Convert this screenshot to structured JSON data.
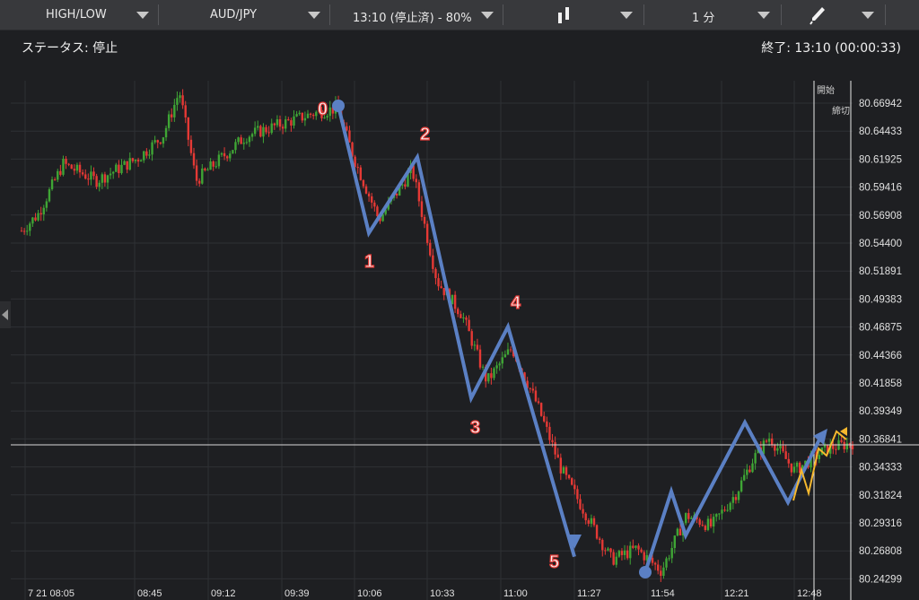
{
  "toolbar": {
    "trade_type": "HIGH/LOW",
    "pair": "AUD/JPY",
    "expiry": "13:10 (停止済) - 80%",
    "interval": "1 分"
  },
  "status": {
    "left": "ステータス: 停止",
    "right": "終了: 13:10 (00:00:33)"
  },
  "markers": {
    "start": "開始",
    "deadline": "締切"
  },
  "colors": {
    "up": "#3fa535",
    "down": "#e53935",
    "wave": "#5b80c4",
    "projection": "#f5b82e",
    "background": "#1e1f22"
  },
  "chart_data": {
    "type": "candlestick",
    "y_ticks": [
      "80.66942",
      "80.64433",
      "80.61925",
      "80.59416",
      "80.56908",
      "80.54400",
      "80.51891",
      "80.49383",
      "80.46875",
      "80.44366",
      "80.41858",
      "80.39349",
      "80.36841",
      "80.34333",
      "80.31824",
      "80.29316",
      "80.26808",
      "80.24299"
    ],
    "x_ticks": [
      "7 21 08:05",
      "08:45",
      "09:12",
      "09:39",
      "10:06",
      "10:33",
      "11:00",
      "11:27",
      "11:54",
      "12:21",
      "12:48"
    ],
    "current_price_line": "80.36841",
    "wave_labels": [
      "0",
      "1",
      "2",
      "3",
      "4",
      "5"
    ],
    "wave_points": [
      {
        "label": "0",
        "y": 80.667
      },
      {
        "label": "1",
        "y": 80.553
      },
      {
        "label": "2",
        "y": 80.621
      },
      {
        "label": "3",
        "y": 80.405
      },
      {
        "label": "4",
        "y": 80.469
      },
      {
        "label": "5",
        "y": 80.258
      }
    ],
    "series_anchors": [
      {
        "t": 0,
        "y": 80.555
      },
      {
        "t": 0.02,
        "y": 80.57
      },
      {
        "t": 0.05,
        "y": 80.615
      },
      {
        "t": 0.09,
        "y": 80.6
      },
      {
        "t": 0.14,
        "y": 80.62
      },
      {
        "t": 0.17,
        "y": 80.64
      },
      {
        "t": 0.19,
        "y": 80.68
      },
      {
        "t": 0.21,
        "y": 80.6
      },
      {
        "t": 0.24,
        "y": 80.62
      },
      {
        "t": 0.27,
        "y": 80.64
      },
      {
        "t": 0.31,
        "y": 80.65
      },
      {
        "t": 0.35,
        "y": 80.66
      },
      {
        "t": 0.38,
        "y": 80.665
      },
      {
        "t": 0.4,
        "y": 80.62
      },
      {
        "t": 0.43,
        "y": 80.565
      },
      {
        "t": 0.47,
        "y": 80.61
      },
      {
        "t": 0.5,
        "y": 80.51
      },
      {
        "t": 0.53,
        "y": 80.48
      },
      {
        "t": 0.56,
        "y": 80.42
      },
      {
        "t": 0.59,
        "y": 80.45
      },
      {
        "t": 0.62,
        "y": 80.4
      },
      {
        "t": 0.65,
        "y": 80.34
      },
      {
        "t": 0.68,
        "y": 80.3
      },
      {
        "t": 0.71,
        "y": 80.26
      },
      {
        "t": 0.74,
        "y": 80.27
      },
      {
        "t": 0.77,
        "y": 80.25
      },
      {
        "t": 0.8,
        "y": 80.3
      },
      {
        "t": 0.83,
        "y": 80.29
      },
      {
        "t": 0.86,
        "y": 80.32
      },
      {
        "t": 0.88,
        "y": 80.35
      },
      {
        "t": 0.9,
        "y": 80.37
      },
      {
        "t": 0.93,
        "y": 80.34
      },
      {
        "t": 0.95,
        "y": 80.35
      },
      {
        "t": 0.97,
        "y": 80.36
      },
      {
        "t": 1.0,
        "y": 80.365
      }
    ]
  }
}
